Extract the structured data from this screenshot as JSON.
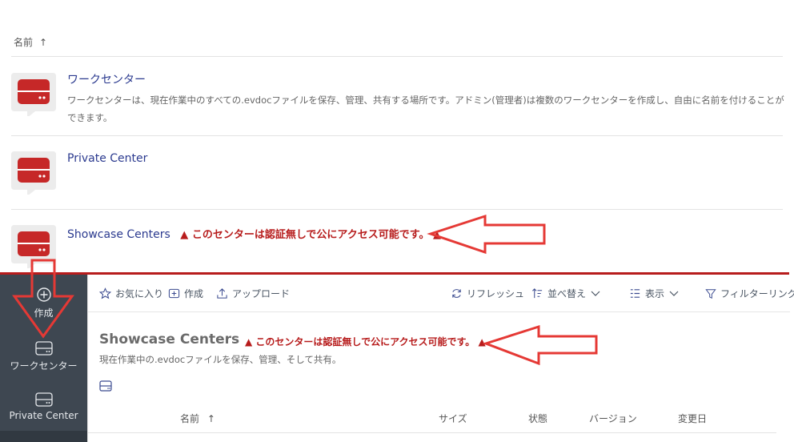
{
  "list_header": {
    "sort_label": "名前",
    "sort_arrow": "↑"
  },
  "centers": [
    {
      "title": "ワークセンター",
      "description": "ワークセンターは、現在作業中のすべての.evdocファイルを保存、管理、共有する場所です。アドミン(管理者)は複数のワークセンターを作成し、自由に名前を付けることができます。",
      "warning": ""
    },
    {
      "title": "Private Center",
      "description": "",
      "warning": ""
    },
    {
      "title": "Showcase Centers",
      "description": "",
      "warning": "このセンターは認証無しで公にアクセス可能です。"
    }
  ],
  "sidebar": {
    "items": [
      {
        "label": "作成",
        "icon": "plus-circle-icon"
      },
      {
        "label": "ワークセンター",
        "icon": "drive-icon"
      },
      {
        "label": "Private Center",
        "icon": "drive-icon"
      }
    ]
  },
  "toolbar": {
    "favorite": "お気に入り",
    "create": "作成",
    "upload": "アップロード",
    "refresh": "リフレッシュ",
    "sort": "並べ替え",
    "view": "表示",
    "filter": "フィルターリング"
  },
  "detail": {
    "title": "Showcase Centers",
    "warning": "このセンターは認証無しで公にアクセス可能です。",
    "description": "現在作業中の.evdocファイルを保存、管理、そして共有。"
  },
  "table": {
    "columns": [
      "名前",
      "サイズ",
      "状態",
      "バージョン",
      "変更日"
    ],
    "sort_arrow": "↑"
  },
  "colors": {
    "warning": "#b71c1c",
    "icon_red": "#c62828",
    "sidebar_bg": "#3e4751",
    "link_blue": "#2b3a8f",
    "annotation_red": "#e53935"
  }
}
